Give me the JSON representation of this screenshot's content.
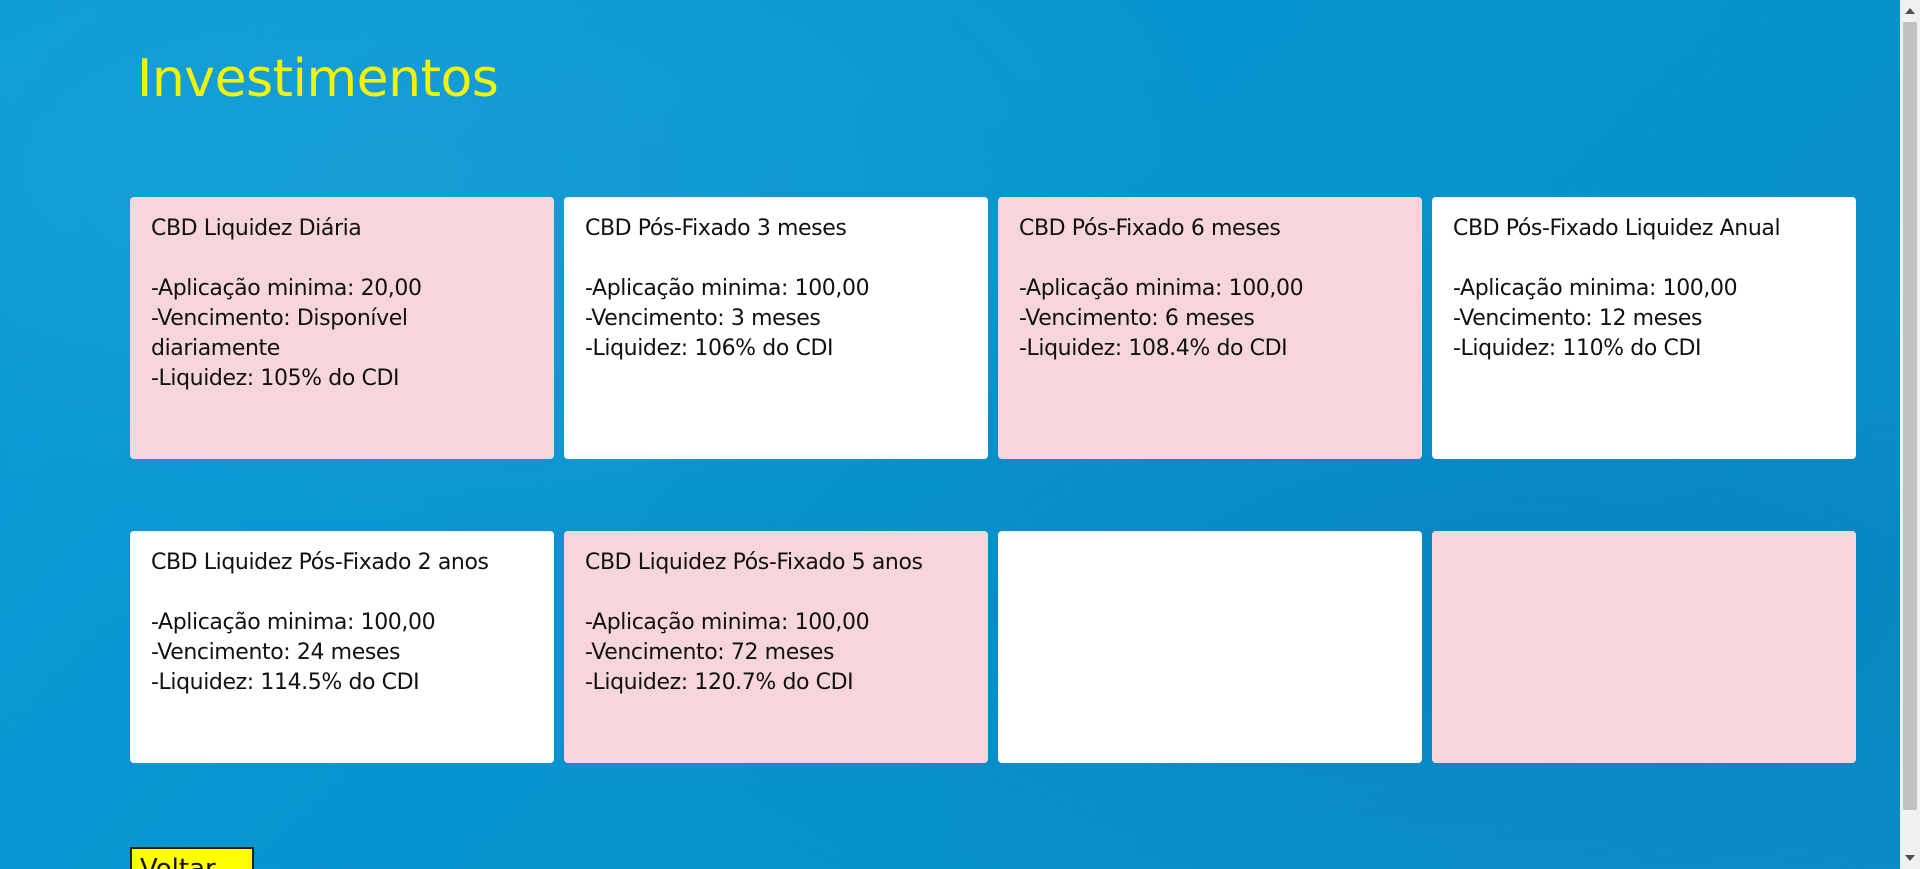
{
  "page": {
    "title": "Investimentos",
    "background_color": "#0a97d2",
    "title_color": "#f2f20c"
  },
  "cards": [
    {
      "title": "CBD Liquidez Diária",
      "lines": [
        "-Aplicação minima: 20,00",
        "-Vencimento: Disponível diariamente",
        "-Liquidez: 105% do CDI"
      ],
      "color": "#f7d6db"
    },
    {
      "title": "CBD Pós-Fixado 3 meses",
      "lines": [
        "-Aplicação minima: 100,00",
        "-Vencimento: 3 meses",
        "-Liquidez: 106% do CDI"
      ],
      "color": "#ffffff"
    },
    {
      "title": "CBD Pós-Fixado 6 meses",
      "lines": [
        "-Aplicação minima: 100,00",
        "-Vencimento: 6 meses",
        "-Liquidez: 108.4% do CDI"
      ],
      "color": "#f7d6db"
    },
    {
      "title": "CBD Pós-Fixado Liquidez Anual",
      "lines": [
        "-Aplicação minima: 100,00",
        "-Vencimento: 12 meses",
        "-Liquidez: 110% do CDI"
      ],
      "color": "#ffffff"
    },
    {
      "title": "CBD Liquidez Pós-Fixado 2 anos",
      "lines": [
        "-Aplicação minima: 100,00",
        "-Vencimento: 24 meses",
        "-Liquidez: 114.5% do CDI"
      ],
      "color": "#ffffff"
    },
    {
      "title": "CBD Liquidez Pós-Fixado 5 anos",
      "lines": [
        "-Aplicação minima: 100,00",
        "-Vencimento: 72 meses",
        "-Liquidez: 120.7% do CDI"
      ],
      "color": "#f7d6db"
    },
    {
      "title": "",
      "lines": [],
      "color": "#ffffff"
    },
    {
      "title": "",
      "lines": [],
      "color": "#f7d6db"
    }
  ],
  "footer_button": {
    "label": "Voltar",
    "color": "#ffff00"
  }
}
